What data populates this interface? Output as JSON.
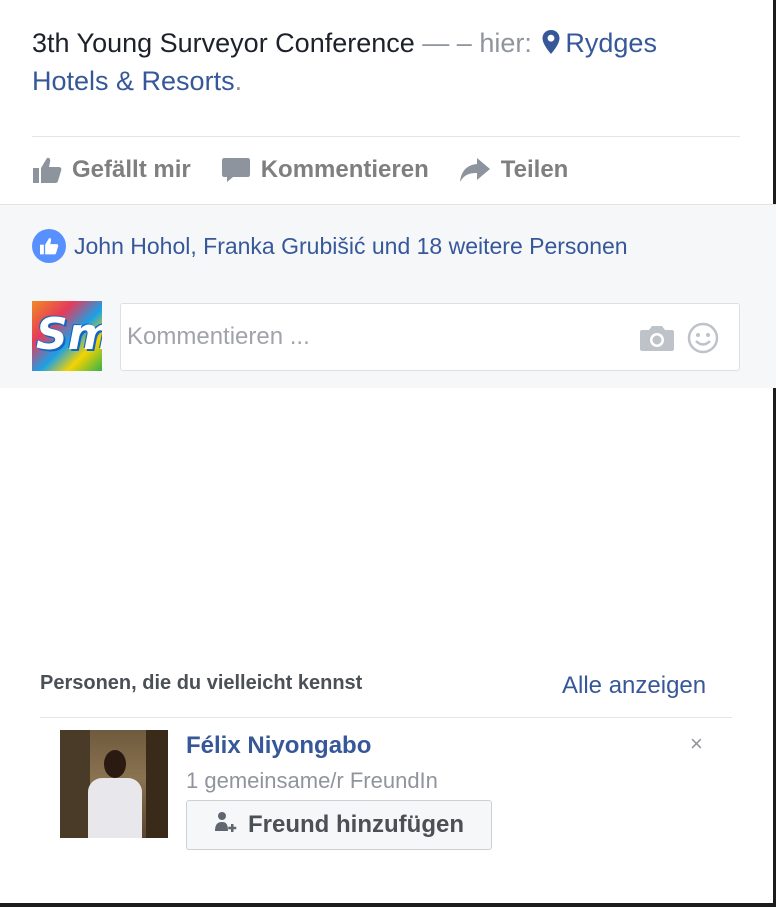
{
  "post": {
    "title": "3th Young Surveyor Conference",
    "dashes": "— –",
    "here_label": "hier:",
    "location_line1": "Rydges",
    "location_line2": "Hotels & Resorts",
    "period": "."
  },
  "actions": {
    "like": "Gefällt mir",
    "comment": "Kommentieren",
    "share": "Teilen"
  },
  "reactions": {
    "likes_text": "John Hohol, Franka Grubišić und 18 weitere Personen"
  },
  "comment_box": {
    "placeholder": "Kommentieren ...",
    "avatar_text": "Sm"
  },
  "pymk": {
    "header": "Personen, die du vielleicht kennst",
    "see_all": "Alle anzeigen",
    "person": {
      "name": "Félix Niyongabo",
      "mutual": "1 gemeinsame/r FreundIn",
      "add_label": "Freund hinzufügen"
    },
    "close": "×"
  },
  "colors": {
    "link": "#365899",
    "muted": "#90949c",
    "like_badge": "#5890ff",
    "panel_bg": "#f6f7f9"
  }
}
